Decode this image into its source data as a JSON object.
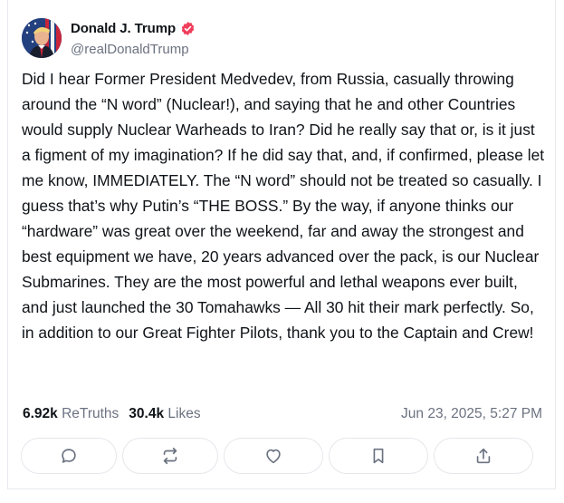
{
  "post": {
    "author": {
      "display_name": "Donald J. Trump",
      "handle": "@realDonaldTrump",
      "verified": true,
      "verified_color": "#ef3e5c"
    },
    "text": "Did I hear Former President Medvedev, from Russia, casually throwing around the “N word” (Nuclear!), and saying that he and other Countries would supply Nuclear Warheads to Iran? Did he really say that or, is it just a figment of my imagination? If he did say that, and, if confirmed, please let me know, IMMEDIATELY. The “N word” should not be treated so casually. I guess that’s why Putin’s “THE BOSS.” By the way, if anyone thinks our “hardware” was great over the weekend, far and away the strongest and best equipment we have, 20 years advanced over the pack, is our Nuclear Submarines. They are the most powerful and lethal weapons ever built, and just launched the 30 Tomahawks — All 30 hit their mark perfectly. So, in addition to our Great Fighter Pilots, thank you to the Captain and Crew!",
    "stats": {
      "retruths_count": "6.92k",
      "retruths_label": "ReTruths",
      "likes_count": "30.4k",
      "likes_label": "Likes"
    },
    "timestamp": "Jun 23, 2025, 5:27 PM"
  },
  "actions": [
    {
      "name": "reply-button",
      "icon": "reply-icon"
    },
    {
      "name": "retruth-button",
      "icon": "repost-icon"
    },
    {
      "name": "like-button",
      "icon": "heart-icon"
    },
    {
      "name": "bookmark-button",
      "icon": "bookmark-icon"
    },
    {
      "name": "share-button",
      "icon": "share-icon"
    }
  ],
  "colors": {
    "text_primary": "#0f1419",
    "text_secondary": "#6b7280",
    "border": "#e5e7eb",
    "icon": "#6b7280"
  }
}
